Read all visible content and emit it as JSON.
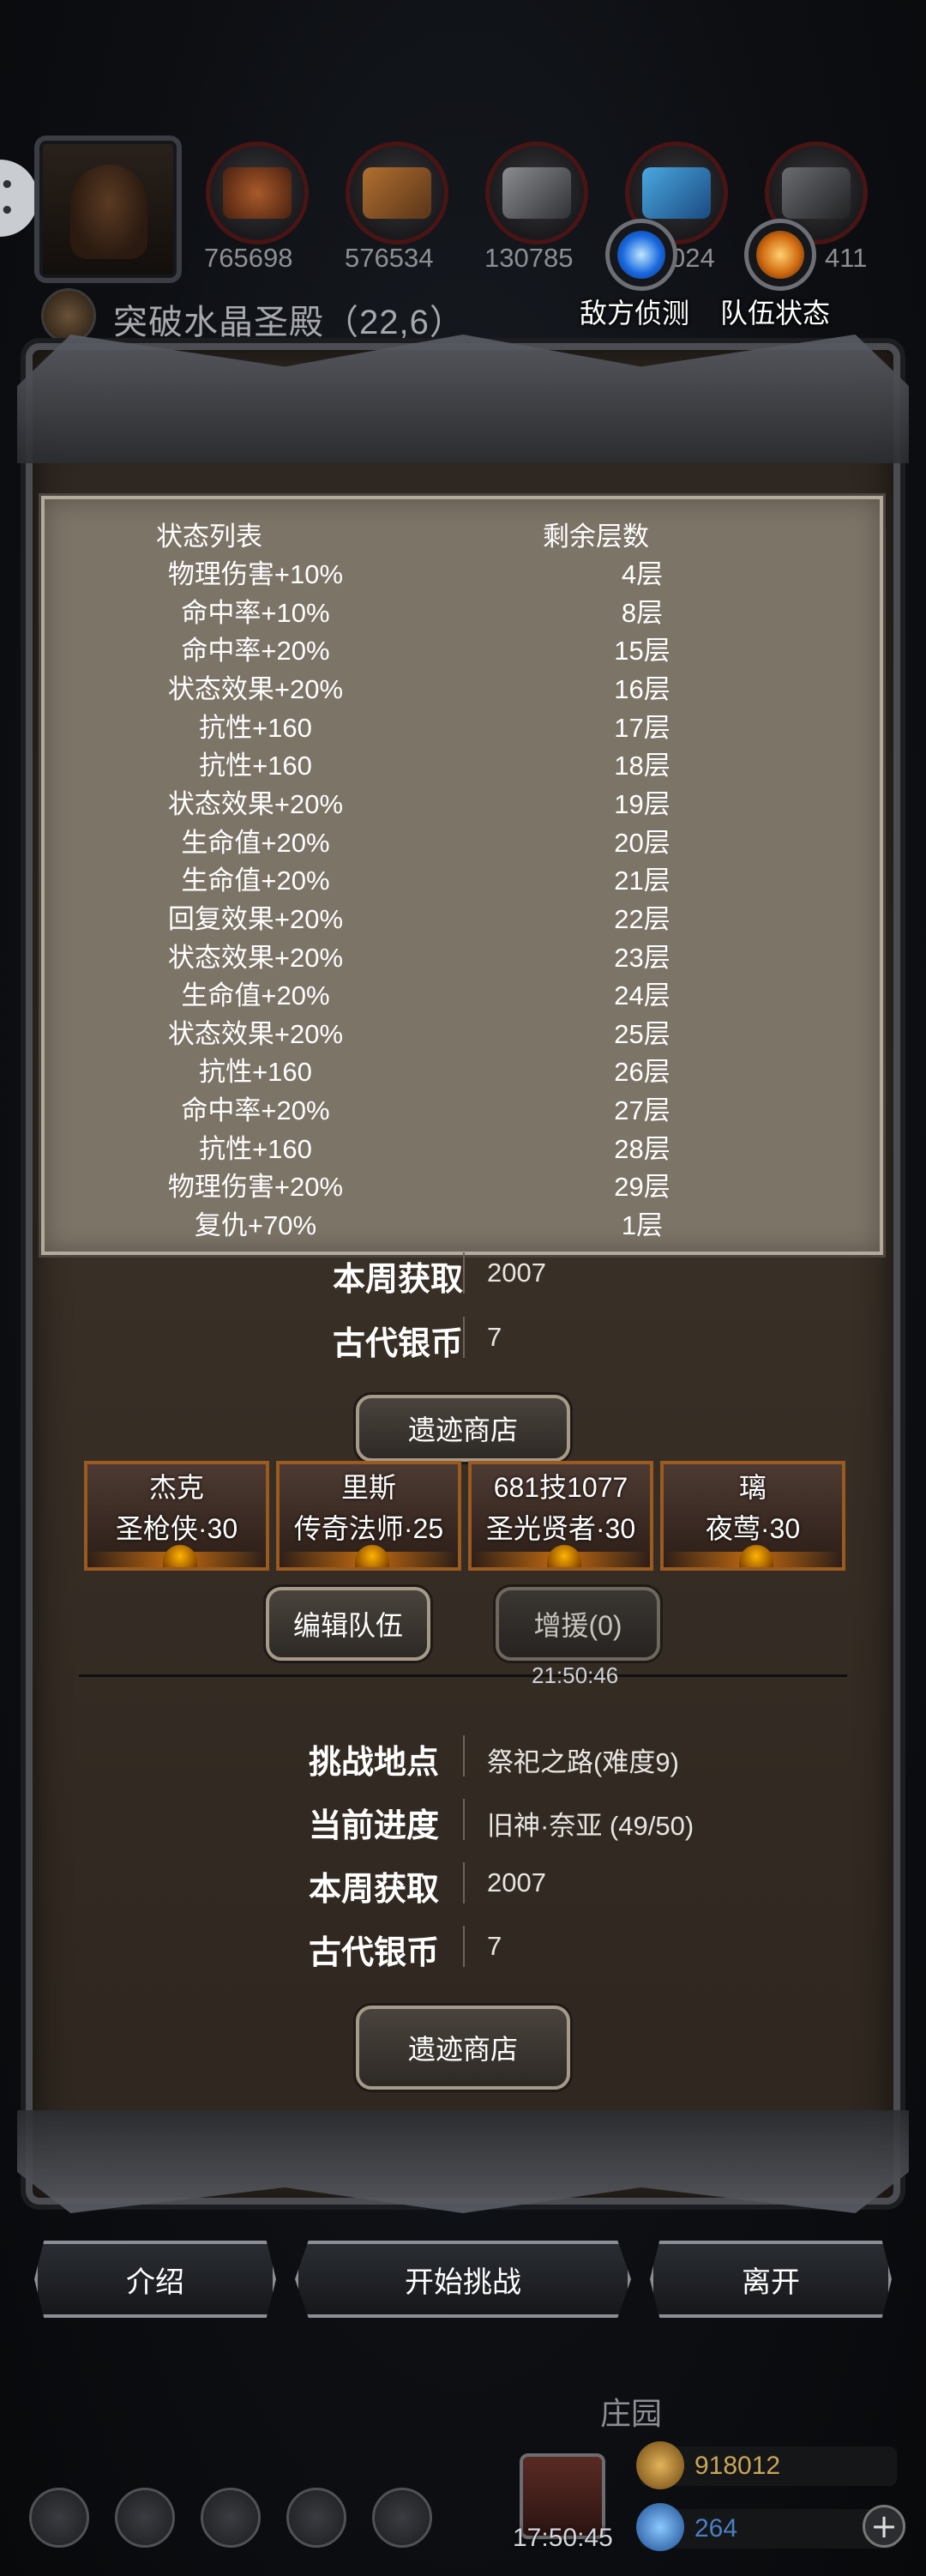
{
  "top": {
    "resources": [
      "765698",
      "576534",
      "130785",
      "024",
      "411"
    ],
    "location": "突破水晶圣殿（22,6）",
    "enemy_scout_label": "敌方侦测",
    "team_status_label": "队伍状态"
  },
  "status_panel": {
    "col_status": "状态列表",
    "col_layers": "剩余层数",
    "rows": [
      {
        "name": "物理伤害+10%",
        "layers": "4层"
      },
      {
        "name": "命中率+10%",
        "layers": "8层"
      },
      {
        "name": "命中率+20%",
        "layers": "15层"
      },
      {
        "name": "状态效果+20%",
        "layers": "16层"
      },
      {
        "name": "抗性+160",
        "layers": "17层"
      },
      {
        "name": "抗性+160",
        "layers": "18层"
      },
      {
        "name": "状态效果+20%",
        "layers": "19层"
      },
      {
        "name": "生命值+20%",
        "layers": "20层"
      },
      {
        "name": "生命值+20%",
        "layers": "21层"
      },
      {
        "name": "回复效果+20%",
        "layers": "22层"
      },
      {
        "name": "状态效果+20%",
        "layers": "23层"
      },
      {
        "name": "生命值+20%",
        "layers": "24层"
      },
      {
        "name": "状态效果+20%",
        "layers": "25层"
      },
      {
        "name": "抗性+160",
        "layers": "26层"
      },
      {
        "name": "命中率+20%",
        "layers": "27层"
      },
      {
        "name": "抗性+160",
        "layers": "28层"
      },
      {
        "name": "物理伤害+20%",
        "layers": "29层"
      },
      {
        "name": "复仇+70%",
        "layers": "1层"
      }
    ]
  },
  "upper_info": {
    "weekly_label": "本周获取",
    "weekly_value": "2007",
    "coin_label": "古代银币",
    "coin_value": "7",
    "shop_button": "遗迹商店"
  },
  "heroes": [
    {
      "name": "杰克",
      "cls": "圣枪侠·30"
    },
    {
      "name": "里斯",
      "cls": "传奇法师·25"
    },
    {
      "name": "681技1077",
      "cls": "圣光贤者·30"
    },
    {
      "name": "璃",
      "cls": "夜莺·30"
    }
  ],
  "team": {
    "edit_button": "编辑队伍",
    "reinforce_button": "增援(0)",
    "timer": "21:50:46"
  },
  "challenge": {
    "place_label": "挑战地点",
    "place_value": "祭祀之路(难度9)",
    "progress_label": "当前进度",
    "progress_value": "旧神·奈亚 (49/50)",
    "weekly_label": "本周获取",
    "weekly_value": "2007",
    "coin_label": "古代银币",
    "coin_value": "7",
    "shop_button": "遗迹商店"
  },
  "actions": {
    "intro": "介绍",
    "start": "开始挑战",
    "leave": "离开"
  },
  "footer": {
    "manor": "庄园",
    "clock": "17:50:45",
    "gold": "918012",
    "gems": "264",
    "plus": "+"
  },
  "colors": {
    "panel_bg": "#7d7468",
    "hero_border": "#9a5a20",
    "gold_text": "#c9a557",
    "gem_text": "#4a7fc4"
  }
}
